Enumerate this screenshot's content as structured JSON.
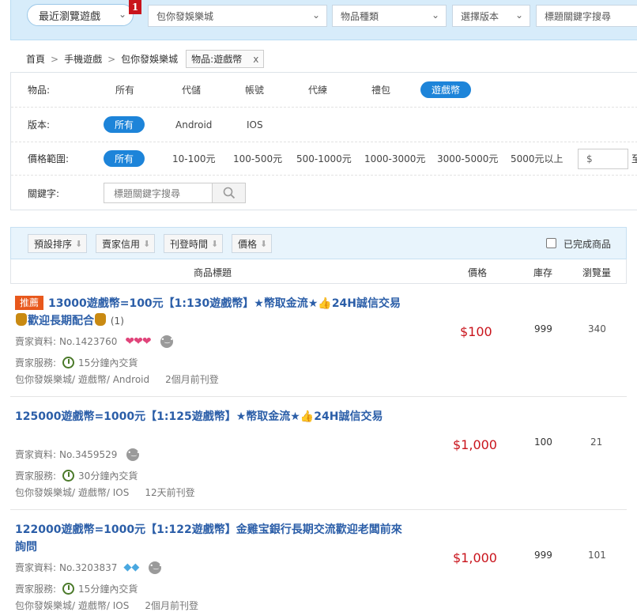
{
  "topbar": {
    "recent_games": "最近瀏覽遊戲",
    "recent_badge": "1",
    "game_select": "包你發娛樂城",
    "category_select": "物品種類",
    "version_select": "選擇版本",
    "keyword_select": "標題關鍵字搜尋"
  },
  "breadcrumb": {
    "home": "首頁",
    "mobile": "手機遊戲",
    "game": "包你發娛樂城",
    "tag": "物品:遊戲幣",
    "tag_close": "x"
  },
  "filters": {
    "item_label": "物品:",
    "item_options": [
      "所有",
      "代儲",
      "帳號",
      "代練",
      "禮包",
      "遊戲幣"
    ],
    "version_label": "版本:",
    "version_options": [
      "所有",
      "Android",
      "IOS"
    ],
    "price_label": "價格範圍:",
    "price_options": [
      "所有",
      "10-100元",
      "100-500元",
      "500-1000元",
      "1000-3000元",
      "3000-5000元",
      "5000元以上"
    ],
    "price_input": "$",
    "price_to": "至",
    "keyword_label": "關鍵字:",
    "keyword_placeholder": "標題關鍵字搜尋"
  },
  "sort": {
    "default": "預設排序",
    "seller": "賣家信用",
    "time": "刊登時間",
    "price": "價格",
    "completed": "已完成商品"
  },
  "table_header": {
    "title": "商品標題",
    "price": "價格",
    "stock": "庫存",
    "views": "瀏覽量"
  },
  "listings": [
    {
      "recommended": "推薦",
      "title_part1": "13000遊戲幣=100元【1:130遊戲幣】",
      "title_part2": "幣取金流",
      "title_part3": "24H誠信交易",
      "title_part4": "歡迎長期配合",
      "rating_count": "(1)",
      "seller_label": "賣家資料:",
      "seller_id": "No.1423760",
      "service_label": "賣家服務:",
      "service": "15分鐘內交貨",
      "path": "包你發娛樂城/ 遊戲幣/ Android",
      "posted": "2個月前刊登",
      "price": "$100",
      "stock": "999",
      "views": "340"
    },
    {
      "title_part1": "125000遊戲幣=1000元【1:125遊戲幣】",
      "title_part2": "幣取金流",
      "title_part3": "24H誠信交易",
      "seller_label": "賣家資料:",
      "seller_id": "No.3459529",
      "service_label": "賣家服務:",
      "service": "30分鐘內交貨",
      "path": "包你發娛樂城/ 遊戲幣/ IOS",
      "posted": "12天前刊登",
      "price": "$1,000",
      "stock": "100",
      "views": "21"
    },
    {
      "title_part1": "122000遊戲幣=1000元【1:122遊戲幣】金雞宝銀行長期交流歡迎老闆前來詢問",
      "seller_label": "賣家資料:",
      "seller_id": "No.3203837",
      "service_label": "賣家服務:",
      "service": "15分鐘內交貨",
      "path": "包你發娛樂城/ 遊戲幣/ IOS",
      "posted": "2個月前刊登",
      "price": "$1,000",
      "stock": "999",
      "views": "101"
    }
  ]
}
